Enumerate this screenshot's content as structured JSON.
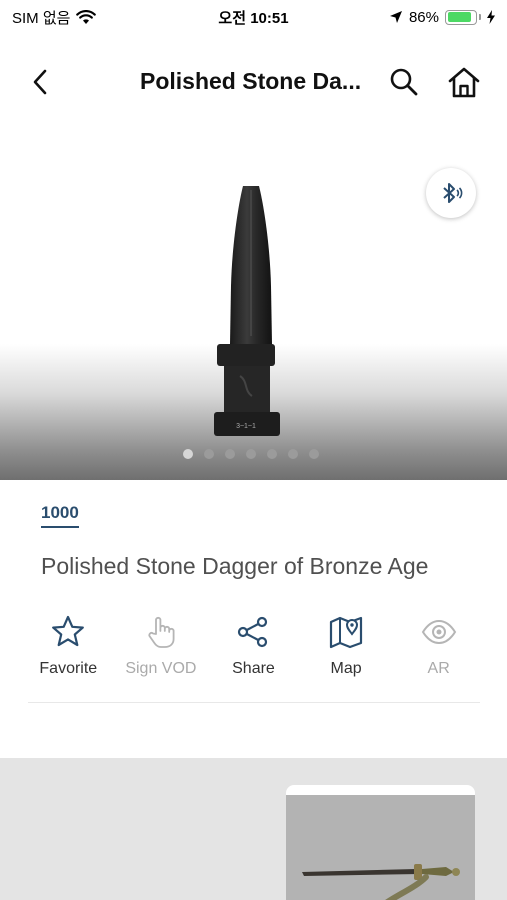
{
  "status_bar": {
    "carrier": "SIM 없음",
    "time": "오전 10:51",
    "battery_percent": "86%",
    "battery_level": 0.86,
    "battery_color": "#4cd964"
  },
  "nav": {
    "title": "Polished Stone Da...",
    "back_icon": "chevron-left-icon",
    "search_icon": "search-icon",
    "home_icon": "home-icon"
  },
  "hero": {
    "image_subject": "polished stone dagger",
    "bluetooth_icon": "bluetooth-audio-icon",
    "page_count": 7,
    "active_page": 1
  },
  "relic": {
    "number": "1000",
    "title": "Polished Stone Dagger of Bronze Age",
    "accent_color": "#2a4d6e"
  },
  "actions": [
    {
      "label": "Favorite",
      "icon": "star-icon",
      "enabled": true
    },
    {
      "label": "Sign VOD",
      "icon": "hand-pointer-icon",
      "enabled": false
    },
    {
      "label": "Share",
      "icon": "share-icon",
      "enabled": true
    },
    {
      "label": "Map",
      "icon": "map-pin-icon",
      "enabled": true
    },
    {
      "label": "AR",
      "icon": "eye-icon",
      "enabled": false
    }
  ],
  "related": {
    "card_image_subject": "bronze sword with tassel"
  }
}
